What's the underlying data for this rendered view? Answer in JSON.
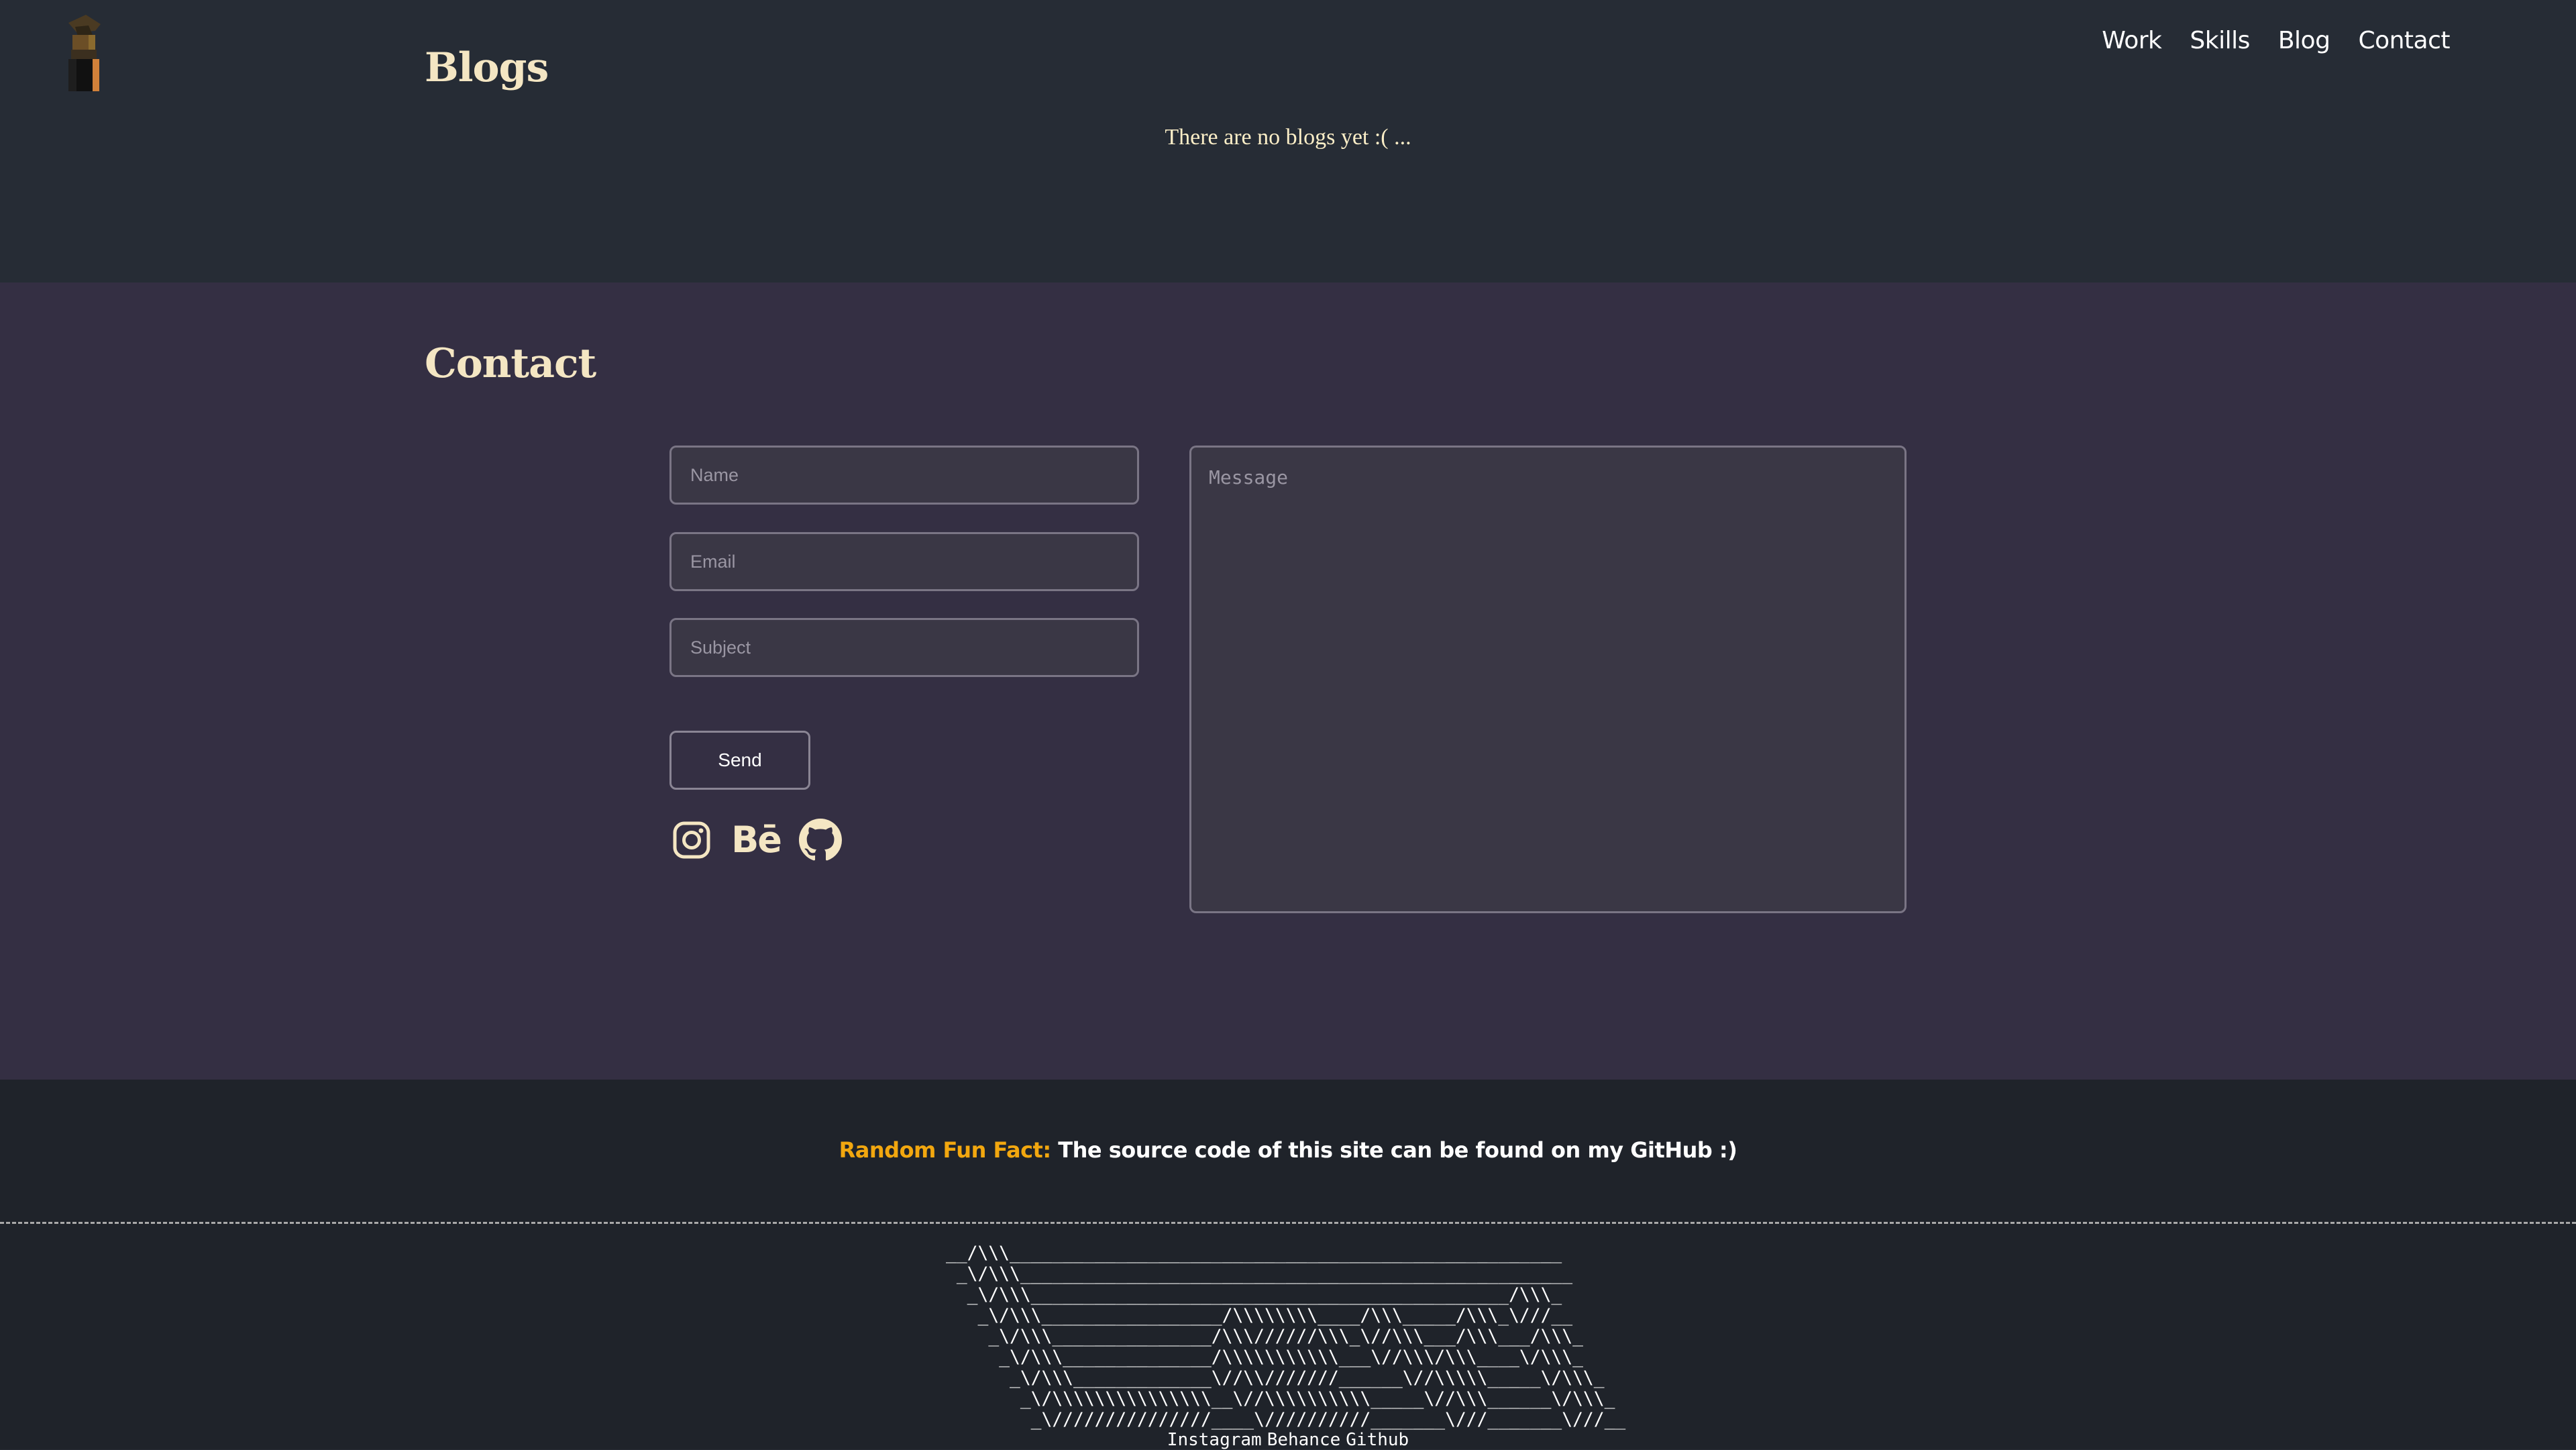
{
  "nav": {
    "items": [
      "Work",
      "Skills",
      "Blog",
      "Contact"
    ]
  },
  "blogs": {
    "title": "Blogs",
    "empty_message": "There are no blogs yet :( ..."
  },
  "contact": {
    "title": "Contact",
    "name_placeholder": "Name",
    "email_placeholder": "Email",
    "subject_placeholder": "Subject",
    "message_placeholder": "Message",
    "send_label": "Send",
    "socials": [
      "instagram-icon",
      "behance-icon",
      "github-icon"
    ],
    "behance_logo_text": "Bē"
  },
  "footer": {
    "fun_fact_label": "Random Fun Fact:",
    "fun_fact_text": " The source code of this site can be found on my GitHub :)",
    "ascii_art": "__/\\\\\\____________________________________________________\n _\\/\\\\\\____________________________________________________\n  _\\/\\\\\\_____________________________________________/\\\\\\_\n   _\\/\\\\\\_________________/\\\\\\\\\\\\\\\\____/\\\\\\_____/\\\\\\_\\///__\n    _\\/\\\\\\_______________/\\\\\\//////\\\\\\_\\//\\\\\\___/\\\\\\___/\\\\\\_\n     _\\/\\\\\\______________/\\\\\\\\\\\\\\\\\\\\\\___\\//\\\\\\/\\\\\\____\\/\\\\\\_\n      _\\/\\\\\\_____________\\//\\\\///////______\\//\\\\\\\\\\_____\\/\\\\\\_\n       _\\/\\\\\\\\\\\\\\\\\\\\\\\\\\\\\\__\\//\\\\\\\\\\\\\\\\\\\\_____\\//\\\\\\______\\/\\\\\\_\n        _\\///////////////____\\//////////_______\\///_______\\///__",
    "links": [
      "Instagram",
      "Behance",
      "Github"
    ]
  },
  "colors": {
    "heading": "#f4e6c3",
    "accent": "#f2a70f",
    "contact_bg": "#342f43",
    "footer_bg": "#1f232a"
  }
}
